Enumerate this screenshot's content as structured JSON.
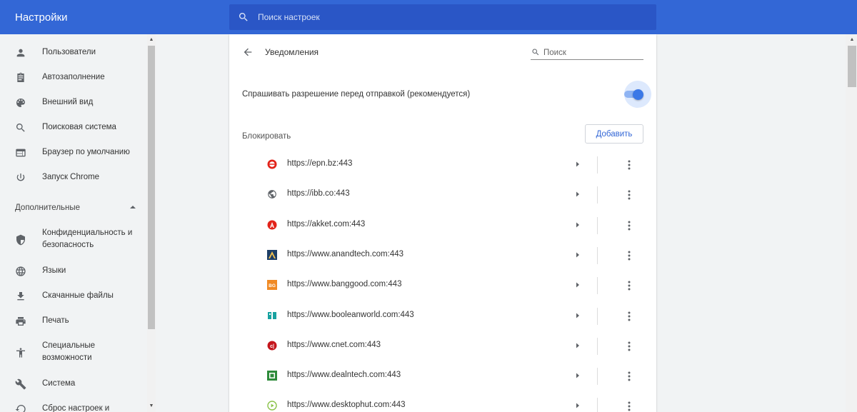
{
  "app": {
    "title": "Настройки",
    "search_placeholder": "Поиск настроек"
  },
  "sidebar": {
    "items": [
      {
        "label": "Пользователи",
        "icon": "person-icon"
      },
      {
        "label": "Автозаполнение",
        "icon": "clipboard-icon"
      },
      {
        "label": "Внешний вид",
        "icon": "palette-icon"
      },
      {
        "label": "Поисковая система",
        "icon": "search-icon"
      },
      {
        "label": "Браузер по умолчанию",
        "icon": "browser-window-icon"
      },
      {
        "label": "Запуск Chrome",
        "icon": "power-icon"
      }
    ],
    "advanced_section": "Дополнительные",
    "advanced_items": [
      {
        "label_line1": "Конфиденциальность и",
        "label_line2": "безопасность",
        "icon": "shield-icon"
      },
      {
        "label_line1": "Языки",
        "label_line2": "",
        "icon": "globe-icon"
      },
      {
        "label_line1": "Скачанные файлы",
        "label_line2": "",
        "icon": "download-icon"
      },
      {
        "label_line1": "Печать",
        "label_line2": "",
        "icon": "printer-icon"
      },
      {
        "label_line1": "Специальные",
        "label_line2": "возможности",
        "icon": "accessibility-icon"
      },
      {
        "label_line1": "Система",
        "label_line2": "",
        "icon": "wrench-icon"
      },
      {
        "label_line1": "Сброс настроек и",
        "label_line2": "",
        "icon": "reset-icon"
      }
    ]
  },
  "notifications": {
    "title": "Уведомления",
    "search_placeholder": "Поиск",
    "ask_label": "Спрашивать разрешение перед отправкой (рекомендуется)",
    "ask_enabled": true,
    "block_label": "Блокировать",
    "add_button": "Добавить",
    "sites": [
      {
        "url": "https://epn.bz:443",
        "favicon": "epn-favicon-icon",
        "color": "#e2231a"
      },
      {
        "url": "https://ibb.co:443",
        "favicon": "globe-favicon-icon",
        "color": "#5f6368"
      },
      {
        "url": "https://akket.com:443",
        "favicon": "akket-favicon-icon",
        "color": "#e2231a"
      },
      {
        "url": "https://www.anandtech.com:443",
        "favicon": "anandtech-favicon-icon",
        "color": "#1e3f66"
      },
      {
        "url": "https://www.banggood.com:443",
        "favicon": "banggood-favicon-icon",
        "color": "#f08a24"
      },
      {
        "url": "https://www.booleanworld.com:443",
        "favicon": "booleanworld-favicon-icon",
        "color": "#17a2a0"
      },
      {
        "url": "https://www.cnet.com:443",
        "favicon": "cnet-favicon-icon",
        "color": "#c4161c"
      },
      {
        "url": "https://www.dealntech.com:443",
        "favicon": "dealntech-favicon-icon",
        "color": "#2e8b3a"
      },
      {
        "url": "https://www.desktophut.com:443",
        "favicon": "desktophut-favicon-icon",
        "color": "#8bc34a"
      }
    ]
  },
  "colors": {
    "header": "#3367d6",
    "accent": "#3b78e7"
  }
}
